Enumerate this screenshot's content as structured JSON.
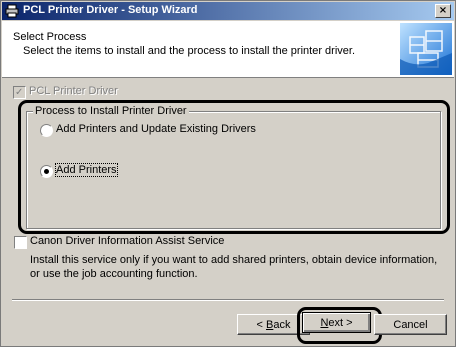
{
  "window": {
    "title": "PCL Printer Driver - Setup Wizard",
    "close_label": "×"
  },
  "header": {
    "title": "Select Process",
    "subtitle": "Select the items to install and the process to install the printer driver."
  },
  "components": {
    "pcl_driver": {
      "label": "PCL Printer Driver",
      "checked": true,
      "enabled": false
    }
  },
  "process_group": {
    "label": "Process to Install Printer Driver",
    "options": [
      {
        "label": "Add Printers and Update Existing Drivers",
        "selected": false
      },
      {
        "label": "Add Printers",
        "selected": true
      }
    ]
  },
  "assist_service": {
    "label": "Canon Driver Information Assist Service",
    "checked": false,
    "description": "Install this service only if you want to add shared printers, obtain device information, or use the job accounting function."
  },
  "buttons": {
    "back": {
      "pre": "< ",
      "key": "B",
      "post": "ack"
    },
    "next": {
      "key": "N",
      "post": "ext >"
    },
    "cancel": "Cancel"
  },
  "colors": {
    "title_gradient_start": "#0a246a",
    "title_gradient_end": "#a6caf0",
    "dialog_face": "#d4d0c8"
  }
}
